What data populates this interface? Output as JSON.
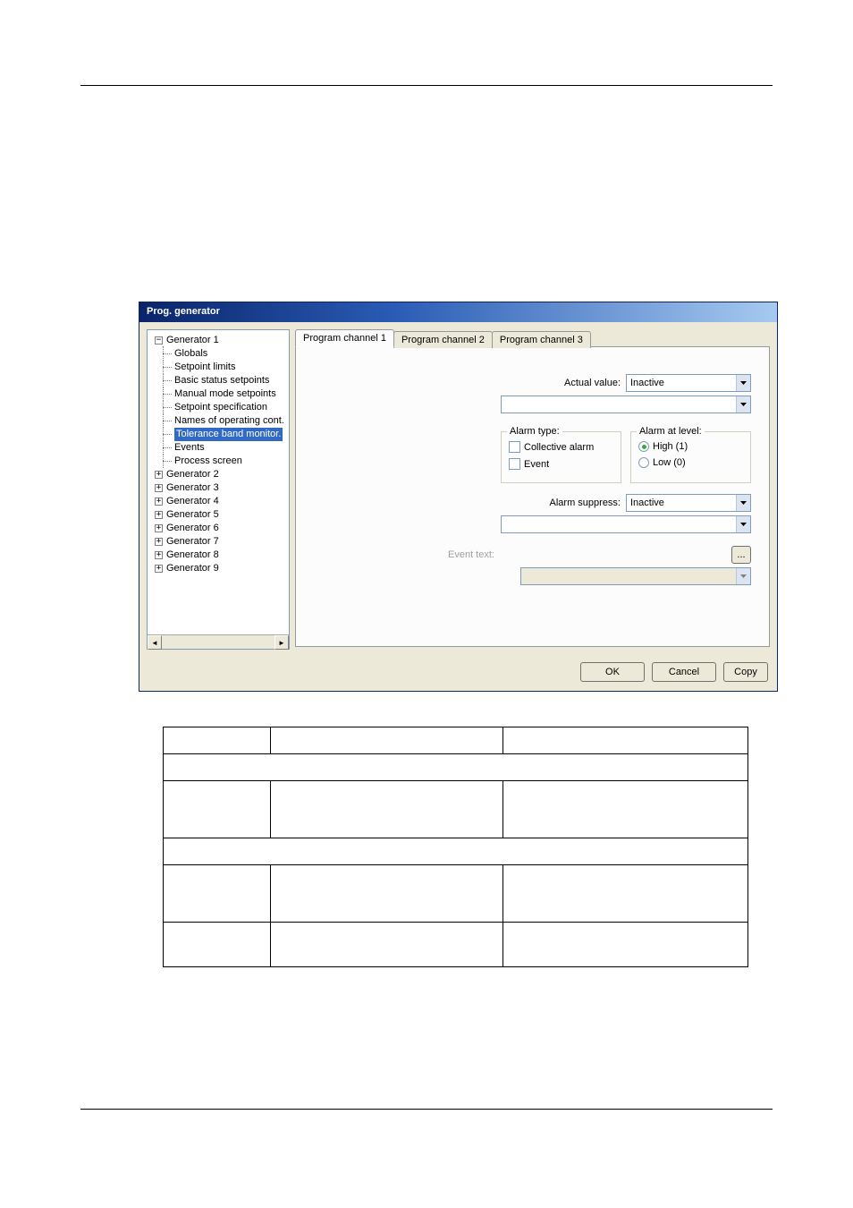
{
  "dialog": {
    "title": "Prog. generator",
    "tree": {
      "root": "Generator 1",
      "children": [
        "Globals",
        "Setpoint limits",
        "Basic status setpoints",
        "Manual mode setpoints",
        "Setpoint specification",
        "Names of operating cont.",
        "Tolerance band monitor.",
        "Events",
        "Process screen"
      ],
      "selected_index": 6,
      "siblings": [
        "Generator 2",
        "Generator 3",
        "Generator 4",
        "Generator 5",
        "Generator 6",
        "Generator 7",
        "Generator 8",
        "Generator 9"
      ]
    },
    "tabs": [
      "Program channel 1",
      "Program channel 2",
      "Program channel 3"
    ],
    "active_tab_index": 0,
    "form": {
      "actual_value_label": "Actual value:",
      "actual_value_value": "Inactive",
      "alarm_type_legend": "Alarm type:",
      "alarm_type_collective": "Collective alarm",
      "alarm_type_event": "Event",
      "alarm_level_legend": "Alarm at level:",
      "alarm_level_high": "High (1)",
      "alarm_level_low": "Low (0)",
      "alarm_level_selected": "high",
      "alarm_suppress_label": "Alarm suppress:",
      "alarm_suppress_value": "Inactive",
      "event_text_label": "Event text:",
      "ellipsis": "..."
    },
    "buttons": {
      "ok": "OK",
      "cancel": "Cancel",
      "copy": "Copy"
    }
  }
}
